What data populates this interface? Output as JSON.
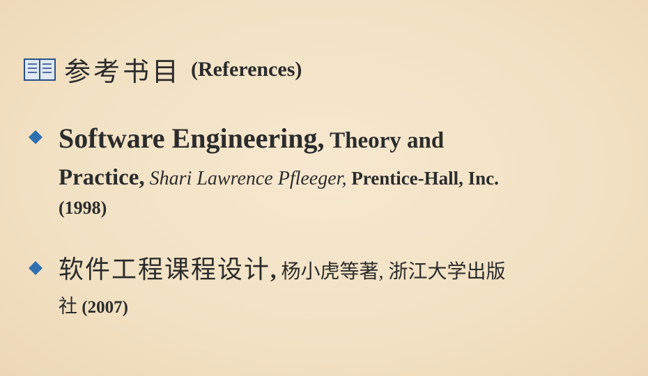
{
  "heading": {
    "cn": "参考书目",
    "en": "(References)",
    "icon": "book-icon"
  },
  "references": [
    {
      "title_part1": "Software Engineering,",
      "title_part2": " Theory and",
      "title_part3": "Practice,",
      "author": " Shari Lawrence Pfleeger,",
      "publisher": " Prentice-Hall, Inc.",
      "year": "(1998)"
    },
    {
      "title": "软件工程课程设计",
      "comma": ",",
      "rest": " 杨小虎等著, 浙江大学出版",
      "rest2": "社",
      "year": " (2007)"
    }
  ],
  "colors": {
    "background": "#f3e3c6",
    "bullet": "#2f6fb0",
    "text": "#2a2a2a"
  }
}
